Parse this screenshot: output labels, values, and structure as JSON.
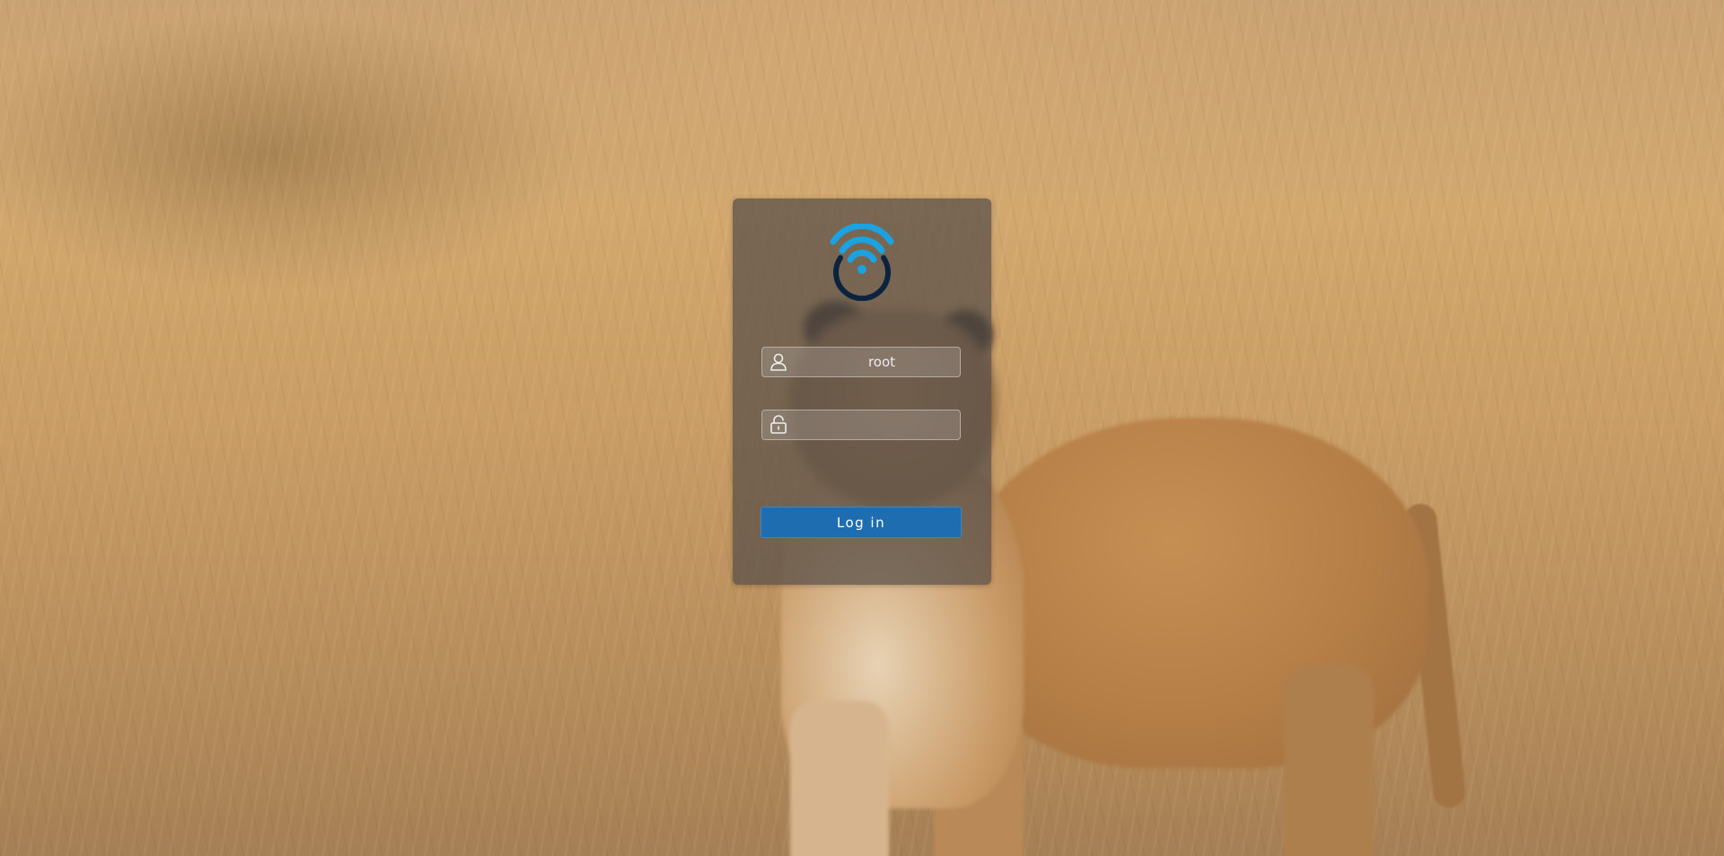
{
  "login": {
    "logo_icon": "wifi-router-logo-icon",
    "username": {
      "icon": "user-icon",
      "value": "root",
      "placeholder": ""
    },
    "password": {
      "icon": "unlocked-padlock-icon",
      "value": "",
      "placeholder": ""
    },
    "submit_label": "Log in"
  },
  "colors": {
    "accent": "#1f6db1",
    "logo_wifi": "#1aa3e0",
    "logo_ring": "#0c2340"
  }
}
